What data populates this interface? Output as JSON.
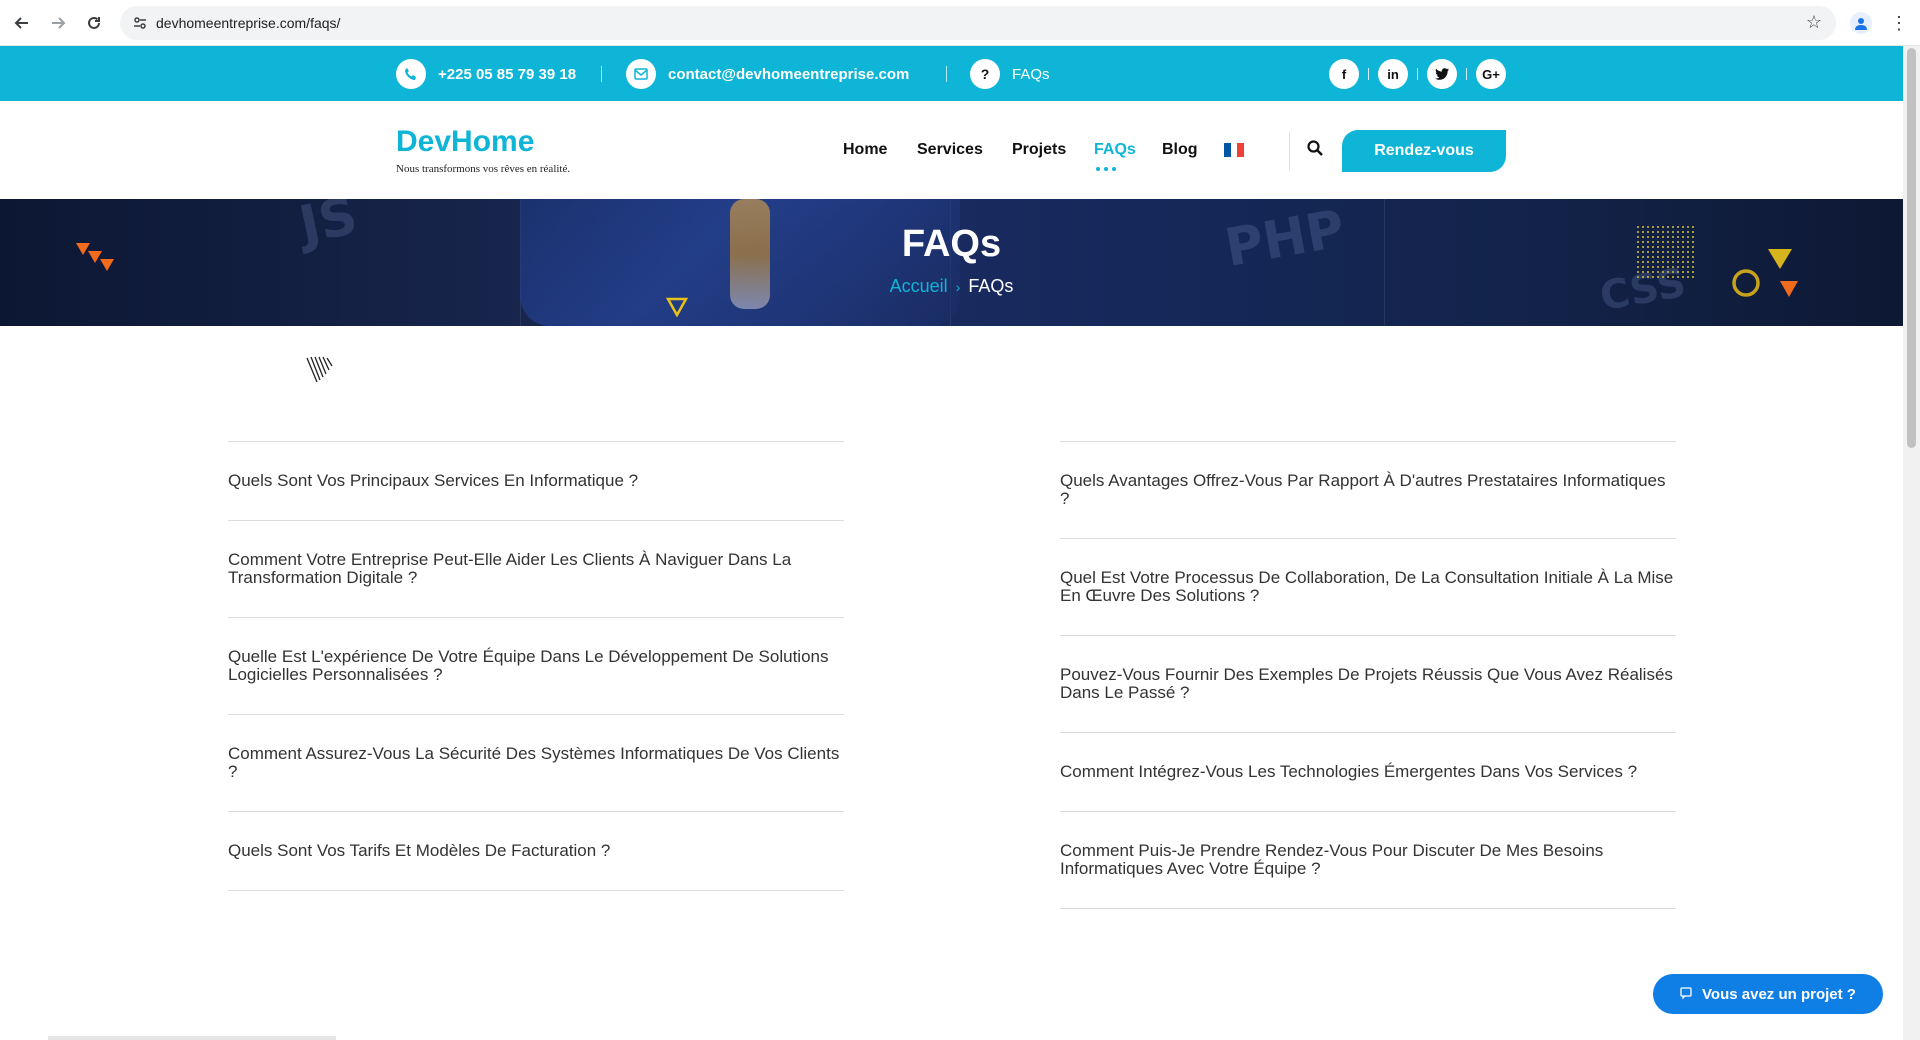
{
  "browser": {
    "url": "devhomeentreprise.com/faqs/",
    "back_icon": "arrow-left-icon",
    "forward_icon": "arrow-right-icon",
    "reload_icon": "reload-icon",
    "bookmark_icon": "star-icon",
    "profile_icon": "profile-icon",
    "menu_icon": "kebab-menu-icon"
  },
  "topbar": {
    "phone": "+225 05 85 79 39 18",
    "email": "contact@devhomeentreprise.com",
    "faq_label": "FAQs",
    "faq_icon_text": "?",
    "social": [
      {
        "name": "facebook",
        "glyph": "f"
      },
      {
        "name": "linkedin",
        "glyph": "in"
      },
      {
        "name": "twitter",
        "glyph": "t"
      },
      {
        "name": "google-plus",
        "glyph": "G+"
      }
    ],
    "color": "#0fb5d6"
  },
  "header": {
    "logo": "DevHome",
    "tagline": "Nous transformons vos rêves en réalité.",
    "nav": [
      "Home",
      "Services",
      "Projets",
      "FAQs",
      "Blog"
    ],
    "active_nav": "FAQs",
    "flag_colors": [
      "#0055a4",
      "#ffffff",
      "#ef4135"
    ],
    "cta_label": "Rendez-vous"
  },
  "banner": {
    "title": "FAQs",
    "breadcrumb_home": "Accueil",
    "breadcrumb_sep": "›",
    "breadcrumb_current": "FAQs",
    "deco_words": [
      "JS",
      "PHP",
      "CSS"
    ]
  },
  "faq": {
    "left": [
      "Quels Sont Vos Principaux Services En Informatique ?",
      "Comment Votre Entreprise Peut-Elle Aider Les Clients À Naviguer Dans La Transformation Digitale ?",
      "Quelle Est L'expérience De Votre Équipe Dans Le Développement De Solutions Logicielles Personnalisées ?",
      "Comment Assurez-Vous La Sécurité Des Systèmes Informatiques De Vos Clients ?",
      "Quels Sont Vos Tarifs Et Modèles De Facturation ?"
    ],
    "right": [
      "Quels Avantages Offrez-Vous Par Rapport À D'autres Prestataires Informatiques ?",
      "Quel Est Votre Processus De Collaboration, De La Consultation Initiale À La Mise En Œuvre Des Solutions ?",
      "Pouvez-Vous Fournir Des Exemples De Projets Réussis Que Vous Avez Réalisés Dans Le Passé ?",
      "Comment Intégrez-Vous Les Technologies Émergentes Dans Vos Services ?",
      "Comment Puis-Je Prendre Rendez-Vous Pour Discuter De Mes Besoins Informatiques Avec Votre Équipe ?"
    ]
  },
  "floating_cta": {
    "label": "Vous avez un projet ?",
    "icon": "chat-icon"
  }
}
